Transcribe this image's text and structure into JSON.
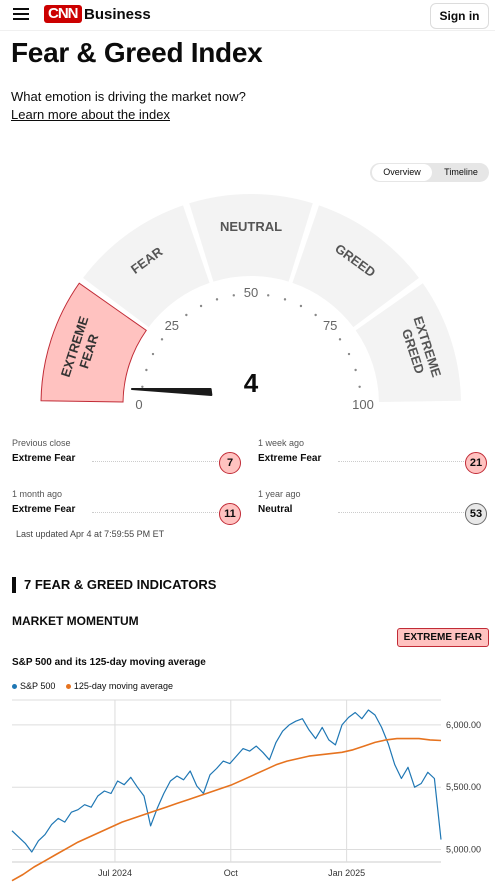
{
  "header": {
    "logo_text": "CNN",
    "brand_suffix": "Business",
    "signin_label": "Sign in"
  },
  "page": {
    "title": "Fear & Greed Index",
    "subtitle": "What emotion is driving the market now?",
    "learn_more": "Learn more about the index",
    "view_toggle": [
      "Overview",
      "Timeline"
    ]
  },
  "gauge": {
    "value": 4,
    "value_label": "4",
    "segments": [
      "EXTREME FEAR",
      "FEAR",
      "NEUTRAL",
      "GREED",
      "EXTREME GREED"
    ],
    "active_segment": "EXTREME FEAR",
    "ticks": [
      "0",
      "25",
      "50",
      "75",
      "100"
    ]
  },
  "history": [
    {
      "label": "Previous close",
      "rating": "Extreme Fear",
      "value": "7",
      "tone": "fear"
    },
    {
      "label": "1 week ago",
      "rating": "Extreme Fear",
      "value": "21",
      "tone": "fear"
    },
    {
      "label": "1 month ago",
      "rating": "Extreme Fear",
      "value": "11",
      "tone": "fear"
    },
    {
      "label": "1 year ago",
      "rating": "Neutral",
      "value": "53",
      "tone": "neutral"
    }
  ],
  "last_updated": "Last updated Apr 4 at 7:59:55 PM ET",
  "indicators": {
    "section_title": "7 FEAR & GREED INDICATORS",
    "market_momentum": {
      "title": "MARKET MOMENTUM",
      "rating": "EXTREME FEAR",
      "chart_title": "S&P 500 and its 125-day moving average"
    }
  },
  "colors": {
    "fear_fill": "#ffc2c0",
    "fear_stroke": "#c12b36",
    "sp500_line": "#1f77b4",
    "ma_line": "#e6731f",
    "brand": "#cc0000"
  },
  "chart_data": {
    "type": "line",
    "title": "S&P 500 and its 125-day moving average",
    "x_tick_labels": [
      "Jul 2024",
      "Oct",
      "Jan 2025"
    ],
    "y_tick_labels": [
      "6,000.00",
      "5,500.00",
      "5,000.00"
    ],
    "ylim": [
      4900,
      6200
    ],
    "grid": true,
    "legend_position": "top-left",
    "series": [
      {
        "name": "S&P 500",
        "values": [
          5150,
          5100,
          5050,
          4980,
          5070,
          5120,
          5200,
          5250,
          5220,
          5300,
          5320,
          5360,
          5340,
          5430,
          5470,
          5450,
          5550,
          5520,
          5580,
          5500,
          5430,
          5190,
          5330,
          5450,
          5550,
          5590,
          5560,
          5630,
          5510,
          5450,
          5600,
          5650,
          5710,
          5690,
          5750,
          5810,
          5790,
          5830,
          5780,
          5720,
          5860,
          5950,
          6000,
          6030,
          6050,
          5960,
          5890,
          5980,
          5880,
          5840,
          6000,
          6060,
          6100,
          6050,
          6120,
          6080,
          5980,
          5850,
          5680,
          5570,
          5660,
          5500,
          5530,
          5620,
          5570,
          5080
        ]
      },
      {
        "name": "125-day moving average",
        "values": [
          4750,
          4800,
          4860,
          4910,
          4960,
          5010,
          5060,
          5100,
          5140,
          5180,
          5220,
          5250,
          5280,
          5310,
          5340,
          5370,
          5400,
          5430,
          5460,
          5490,
          5520,
          5560,
          5600,
          5640,
          5680,
          5710,
          5730,
          5750,
          5760,
          5770,
          5780,
          5800,
          5830,
          5860,
          5880,
          5890,
          5890,
          5890,
          5880,
          5875
        ]
      }
    ]
  }
}
